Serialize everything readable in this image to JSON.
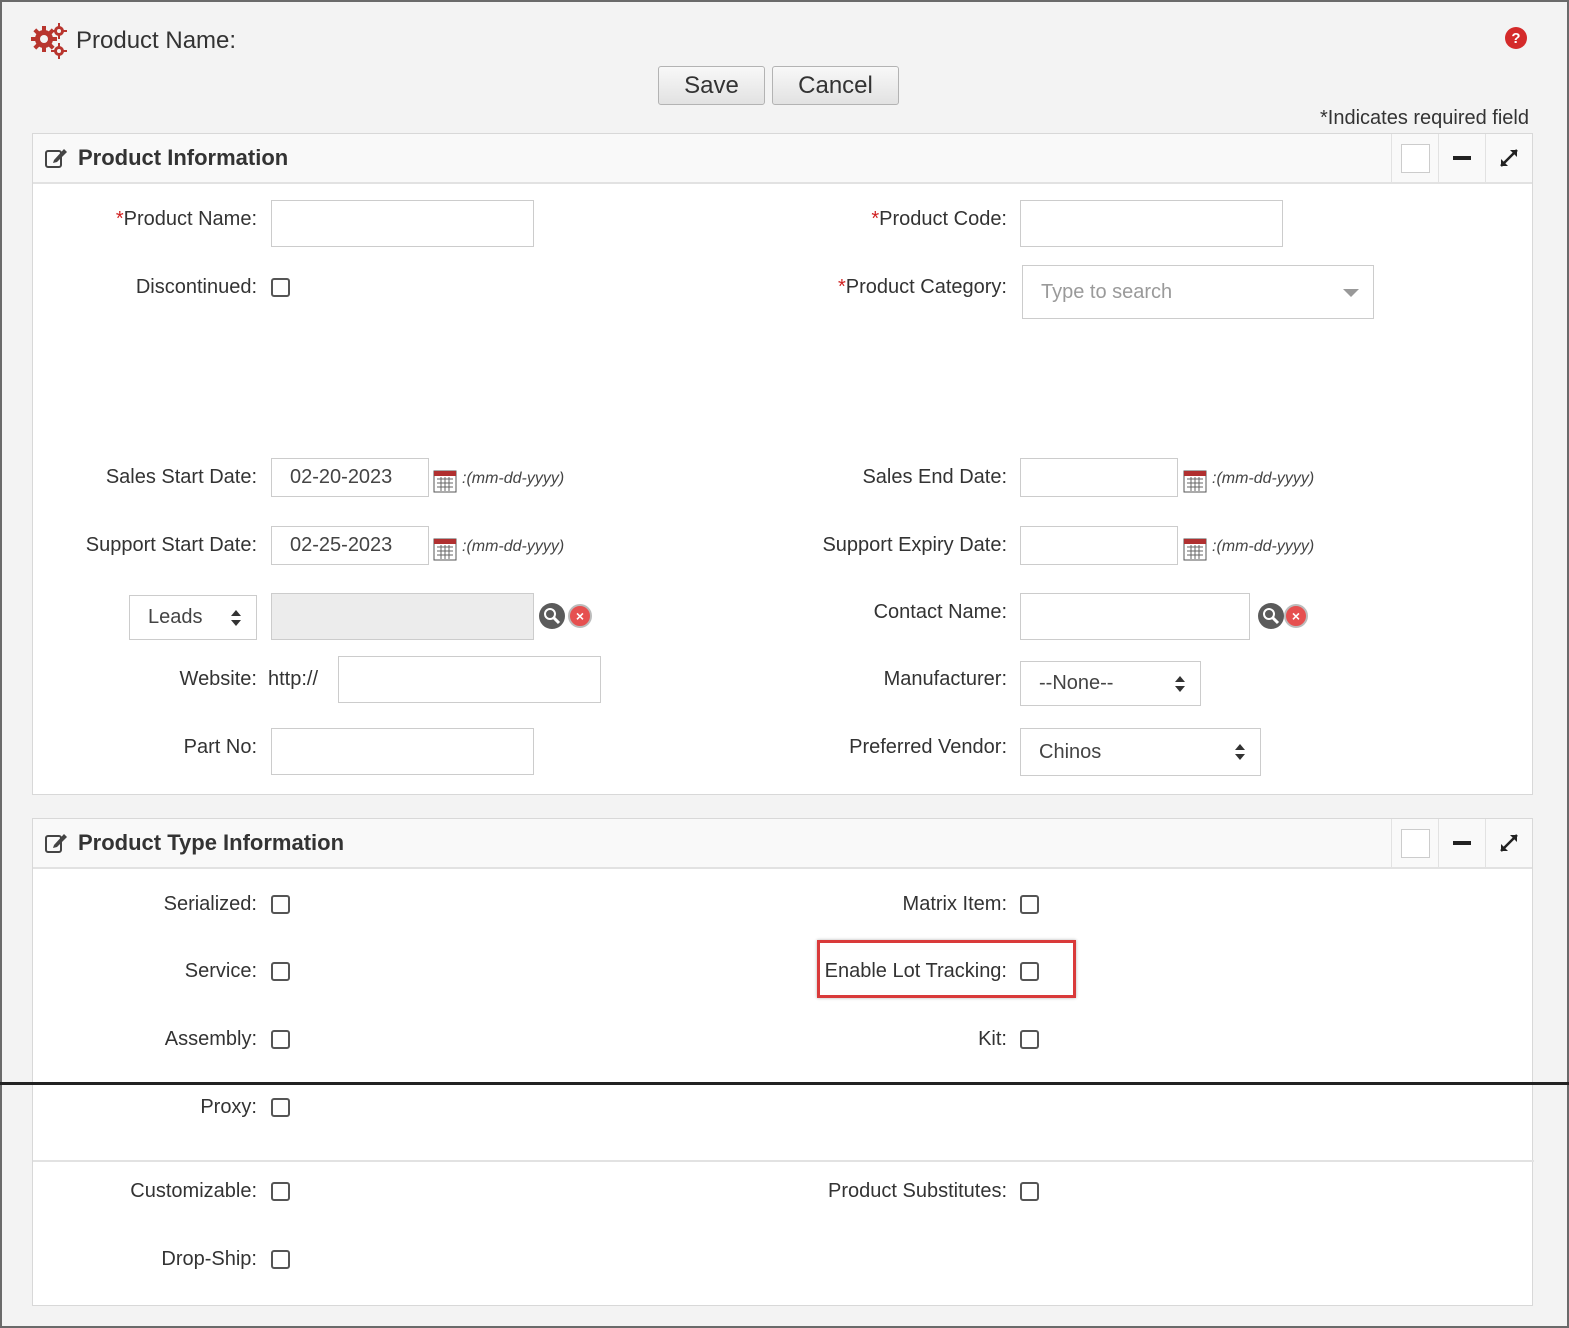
{
  "header": {
    "title": "Product Name:",
    "icon": "gears-icon",
    "help_icon": "help-icon",
    "save_label": "Save",
    "cancel_label": "Cancel",
    "required_note": "*Indicates required field"
  },
  "colors": {
    "accent": "#d42a2a",
    "highlight": "#d93a3a"
  },
  "product_info": {
    "title": "Product Information",
    "required_mark": "*",
    "product_name_label": "Product Name:",
    "product_name_value": "",
    "product_code_label": "Product Code:",
    "product_code_value": "",
    "discontinued_label": "Discontinued:",
    "product_category_label": "Product Category:",
    "product_category_placeholder": "Type to search",
    "sales_start_label": "Sales Start Date:",
    "sales_start_value": "02-20-2023",
    "sales_end_label": "Sales End Date:",
    "sales_end_value": "",
    "support_start_label": "Support Start Date:",
    "support_start_value": "02-25-2023",
    "support_expiry_label": "Support Expiry Date:",
    "support_expiry_value": "",
    "date_format": ":(mm-dd-yyyy)",
    "related_select_value": "Leads",
    "contact_name_label": "Contact Name:",
    "website_label": "Website:",
    "website_prefix": "http://",
    "manufacturer_label": "Manufacturer:",
    "manufacturer_value": "--None--",
    "part_no_label": "Part No:",
    "preferred_vendor_label": "Preferred Vendor:",
    "preferred_vendor_value": "Chinos"
  },
  "product_type": {
    "title": "Product Type Information",
    "serialized_label": "Serialized:",
    "matrix_item_label": "Matrix Item:",
    "service_label": "Service:",
    "enable_lot_tracking_label": "Enable Lot Tracking:",
    "assembly_label": "Assembly:",
    "kit_label": "Kit:",
    "proxy_label": "Proxy:",
    "customizable_label": "Customizable:",
    "product_substitutes_label": "Product Substitutes:",
    "drop_ship_label": "Drop-Ship:"
  }
}
